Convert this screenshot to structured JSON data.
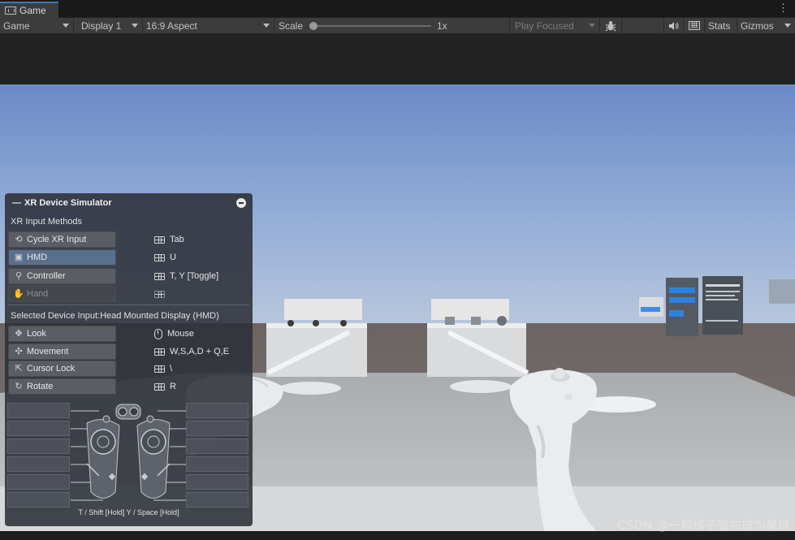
{
  "window": {
    "tab_title": "Game",
    "menu_icon": "kebab-icon"
  },
  "toolbar": {
    "mode": "Game",
    "display": "Display 1",
    "aspect": "16:9 Aspect",
    "scale_label": "Scale",
    "scale_value": "1x",
    "play_mode": "Play Focused",
    "stats_label": "Stats",
    "gizmos_label": "Gizmos"
  },
  "simulator": {
    "title": "XR Device Simulator",
    "input_methods_heading": "XR Input Methods",
    "input_methods": [
      {
        "label": "Cycle XR Input",
        "key": "Tab",
        "icon": "cycle-icon",
        "key_icon": "keyboard-icon",
        "state": "normal"
      },
      {
        "label": "HMD",
        "key": "U",
        "icon": "hmd-icon",
        "key_icon": "keyboard-icon",
        "state": "selected"
      },
      {
        "label": "Controller",
        "key": "T, Y [Toggle]",
        "icon": "controller-icon",
        "key_icon": "keyboard-icon",
        "state": "normal"
      },
      {
        "label": "Hand",
        "key": "",
        "icon": "hand-icon",
        "key_icon": "keyboard-icon",
        "state": "disabled"
      }
    ],
    "selected_device_label": "Selected Device Input:Head Mounted Display (HMD)",
    "device_inputs": [
      {
        "label": "Look",
        "key": "Mouse",
        "icon": "look-icon",
        "key_icon": "mouse-icon"
      },
      {
        "label": "Movement",
        "key": "W,S,A,D + Q,E",
        "icon": "move-icon",
        "key_icon": "keyboard-icon"
      },
      {
        "label": "Cursor Lock",
        "key": "\\",
        "icon": "cursor-icon",
        "key_icon": "keyboard-icon"
      },
      {
        "label": "Rotate",
        "key": "R",
        "icon": "rotate-icon",
        "key_icon": "keyboard-icon"
      }
    ],
    "controller_caption": "T / Shift [Hold]   Y / Space [Hold]"
  },
  "watermark": "CSDN @一颗橘子宣布成为星球",
  "colors": {
    "tab_accent": "#3a79bb",
    "selected_row": "#58708d",
    "sky_top": "#7190c9",
    "ground": "#706c6a",
    "floor": "#b2b4b6"
  }
}
